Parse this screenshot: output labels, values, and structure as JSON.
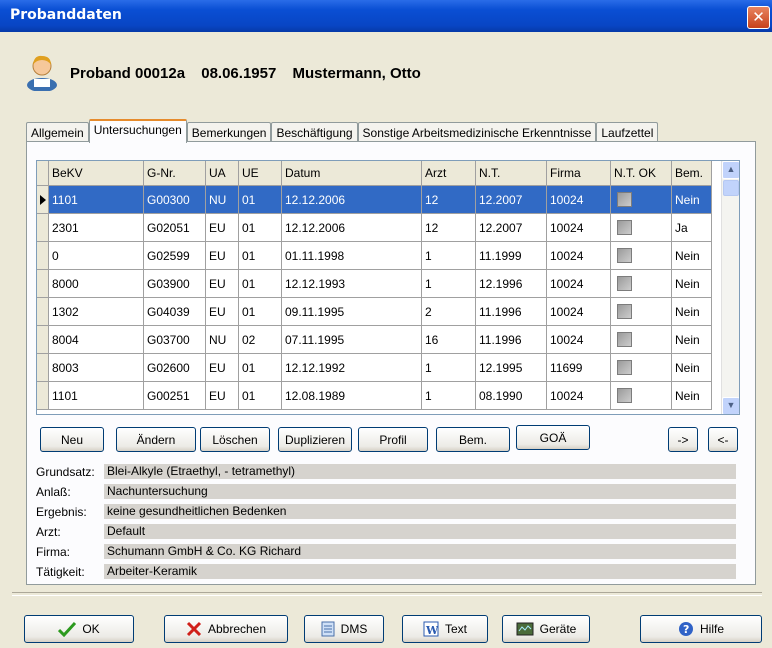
{
  "window": {
    "title": "Probanddaten",
    "close_icon": "close-icon"
  },
  "header": {
    "proband_id": "Proband 00012a",
    "birth_date": "08.06.1957",
    "name": "Mustermann, Otto"
  },
  "tabs": [
    {
      "label": "Allgemein",
      "active": false
    },
    {
      "label": "Untersuchungen",
      "active": true
    },
    {
      "label": "Bemerkungen",
      "active": false
    },
    {
      "label": "Beschäftigung",
      "active": false
    },
    {
      "label": "Sonstige Arbeitsmedizinische Erkenntnisse",
      "active": false
    },
    {
      "label": "Laufzettel",
      "active": false
    }
  ],
  "grid": {
    "columns": [
      "BeKV",
      "G-Nr.",
      "UA",
      "UE",
      "Datum",
      "Arzt",
      "N.T.",
      "Firma",
      "N.T. OK",
      "Bem."
    ],
    "rows": [
      {
        "bekv": "1101",
        "gnr": "G00300",
        "ua": "NU",
        "ue": "01",
        "datum": "12.12.2006",
        "arzt": "12",
        "nt": "12.2007",
        "firma": "10024",
        "ntok": false,
        "bem": "Nein",
        "selected": true
      },
      {
        "bekv": "2301",
        "gnr": "G02051",
        "ua": "EU",
        "ue": "01",
        "datum": "12.12.2006",
        "arzt": "12",
        "nt": "12.2007",
        "firma": "10024",
        "ntok": false,
        "bem": "Ja",
        "selected": false
      },
      {
        "bekv": "0",
        "gnr": "G02599",
        "ua": "EU",
        "ue": "01",
        "datum": "01.11.1998",
        "arzt": "1",
        "nt": "11.1999",
        "firma": "10024",
        "ntok": false,
        "bem": "Nein",
        "selected": false
      },
      {
        "bekv": "8000",
        "gnr": "G03900",
        "ua": "EU",
        "ue": "01",
        "datum": "12.12.1993",
        "arzt": "1",
        "nt": "12.1996",
        "firma": "10024",
        "ntok": false,
        "bem": "Nein",
        "selected": false
      },
      {
        "bekv": "1302",
        "gnr": "G04039",
        "ua": "EU",
        "ue": "01",
        "datum": "09.11.1995",
        "arzt": "2",
        "nt": "11.1996",
        "firma": "10024",
        "ntok": false,
        "bem": "Nein",
        "selected": false
      },
      {
        "bekv": "8004",
        "gnr": "G03700",
        "ua": "NU",
        "ue": "02",
        "datum": "07.11.1995",
        "arzt": "16",
        "nt": "11.1996",
        "firma": "10024",
        "ntok": false,
        "bem": "Nein",
        "selected": false
      },
      {
        "bekv": "8003",
        "gnr": "G02600",
        "ua": "EU",
        "ue": "01",
        "datum": "12.12.1992",
        "arzt": "1",
        "nt": "12.1995",
        "firma": "11699",
        "ntok": false,
        "bem": "Nein",
        "selected": false
      },
      {
        "bekv": "1101",
        "gnr": "G00251",
        "ua": "EU",
        "ue": "01",
        "datum": "12.08.1989",
        "arzt": "1",
        "nt": "08.1990",
        "firma": "10024",
        "ntok": false,
        "bem": "Nein",
        "selected": false
      }
    ]
  },
  "actions": {
    "neu": "Neu",
    "aendern": "Ändern",
    "loeschen": "Löschen",
    "duplizieren": "Duplizieren",
    "profil": "Profil",
    "bem": "Bem.",
    "goae": "GOÄ",
    "next": "->",
    "prev": "<-"
  },
  "info": {
    "grundsatz_label": "Grundsatz:",
    "grundsatz": "Blei-Alkyle (Etraethyl, - tetramethyl)",
    "anlass_label": "Anlaß:",
    "anlass": "Nachuntersuchung",
    "ergebnis_label": "Ergebnis:",
    "ergebnis": "keine gesundheitlichen Bedenken",
    "arzt_label": "Arzt:",
    "arzt": "Default",
    "firma_label": "Firma:",
    "firma": "Schumann GmbH & Co. KG Richard",
    "taetigkeit_label": "Tätigkeit:",
    "taetigkeit": "Arbeiter-Keramik"
  },
  "bottom": {
    "ok": "OK",
    "abbrechen": "Abbrechen",
    "dms": "DMS",
    "text": "Text",
    "geraete": "Geräte",
    "hilfe": "Hilfe"
  },
  "colors": {
    "titlebar": "#0a4fd4",
    "selection": "#316ac5",
    "active_tab": "#e68b2c"
  }
}
